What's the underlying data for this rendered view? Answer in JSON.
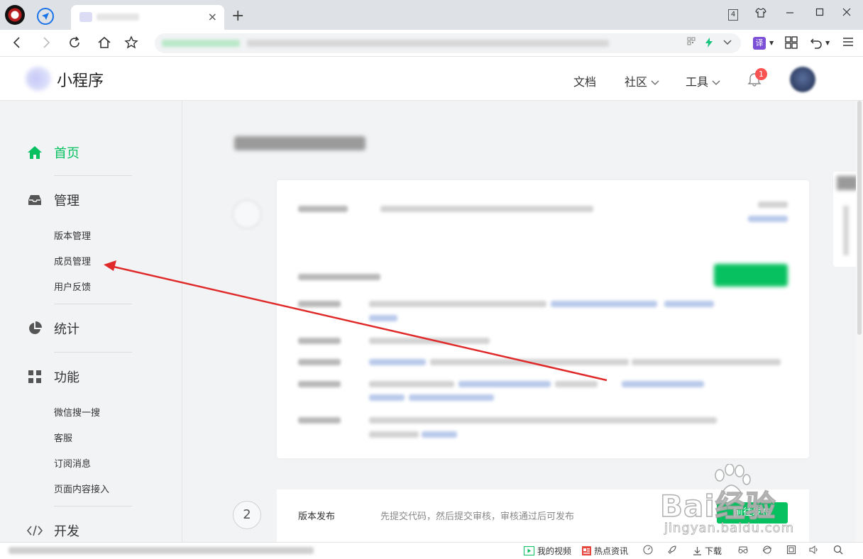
{
  "browser": {
    "tab_close": "×",
    "new_tab": "+",
    "tab_count": "4",
    "translate_label": "译"
  },
  "header": {
    "brand": "小程序",
    "nav": [
      "文档",
      "社区",
      "工具"
    ],
    "notification_count": "1"
  },
  "sidebar": {
    "sections": [
      {
        "label": "首页",
        "icon": "home-icon",
        "active": true,
        "items": []
      },
      {
        "label": "管理",
        "icon": "inbox-icon",
        "active": false,
        "items": [
          "版本管理",
          "成员管理",
          "用户反馈"
        ]
      },
      {
        "label": "统计",
        "icon": "pie-chart-icon",
        "active": false,
        "items": []
      },
      {
        "label": "功能",
        "icon": "grid-icon",
        "active": false,
        "items": [
          "微信搜一搜",
          "客服",
          "订阅消息",
          "页面内容接入"
        ]
      },
      {
        "label": "开发",
        "icon": "code-icon",
        "active": false,
        "items": []
      }
    ]
  },
  "main": {
    "step2": {
      "number": "2",
      "title": "版本发布",
      "description": "先提交代码，然后提交审核，审核通过后可发布",
      "button": "前往发布"
    }
  },
  "watermark": {
    "text": "Bai经验",
    "sub": "jingyan.baidu.com"
  },
  "statusbar": {
    "my_video": "我的视频",
    "hot_news": "热点资讯",
    "download": "下载"
  },
  "colors": {
    "accent": "#07c160",
    "badge": "#fa5151",
    "annotation": "#e02a2a"
  }
}
